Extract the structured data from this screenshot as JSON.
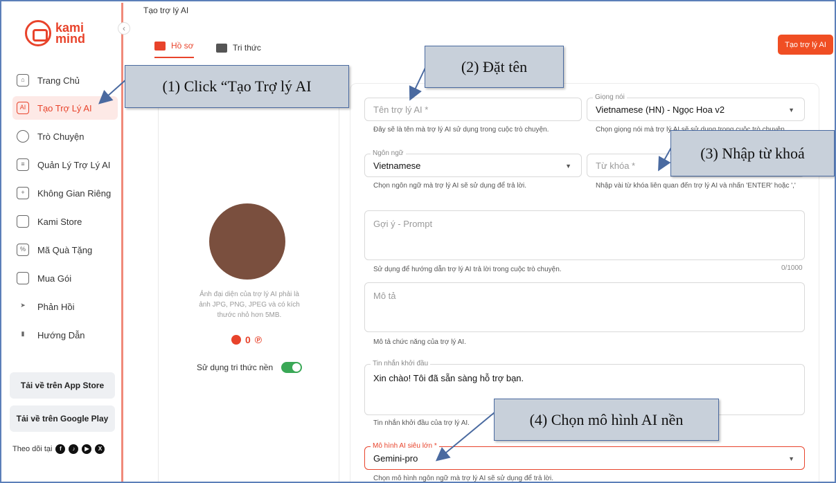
{
  "sidebar": {
    "logo_line1": "kami",
    "logo_line2": "mind",
    "collapse_icon": "‹",
    "items": [
      {
        "label": "Trang Chủ",
        "icon": "home-icon",
        "glyph": "⌂"
      },
      {
        "label": "Tạo Trợ Lý AI",
        "icon": "create-ai-icon",
        "glyph": "AI"
      },
      {
        "label": "Trò Chuyện",
        "icon": "chat-icon",
        "glyph": ""
      },
      {
        "label": "Quản Lý Trợ Lý AI",
        "icon": "manage-icon",
        "glyph": "≡"
      },
      {
        "label": "Không Gian Riêng",
        "icon": "space-icon",
        "glyph": "+"
      },
      {
        "label": "Kami Store",
        "icon": "store-icon",
        "glyph": ""
      },
      {
        "label": "Mã Quà Tặng",
        "icon": "gift-code-icon",
        "glyph": "%"
      },
      {
        "label": "Mua Gói",
        "icon": "wallet-icon",
        "glyph": ""
      },
      {
        "label": "Phản Hồi",
        "icon": "send-icon",
        "glyph": "➤"
      },
      {
        "label": "Hướng Dẫn",
        "icon": "book-icon",
        "glyph": "▮"
      }
    ],
    "app_store": "Tải về trên App Store",
    "google_play": "Tải về trên Google Play",
    "follow": "Theo dõi tại",
    "socials": [
      "f",
      "♪",
      "▶",
      "X"
    ]
  },
  "header": {
    "title": "Tạo trợ lý AI",
    "tab_profile": "Hồ sơ",
    "tab_knowledge": "Tri thức",
    "create_button": "Tạo trợ lý AI"
  },
  "profile": {
    "avatar_hint": "Ảnh đại diện của trợ lý AI phải là ảnh JPG, PNG, JPEG và có kích thước nhỏ hơn 5MB.",
    "points": "0",
    "points_unit": "℗",
    "use_knowledge_label": "Sử dụng tri thức nền",
    "use_knowledge_on": true
  },
  "form": {
    "name_placeholder": "Tên trợ lý AI *",
    "name_help": "Đây sẽ là tên mà trợ lý AI sử dụng trong cuộc trò chuyện.",
    "voice_label": "Giọng nói",
    "voice_value": "Vietnamese (HN) - Ngọc Hoa v2",
    "voice_help": "Chọn giọng nói mà trợ lý AI sẽ sử dụng trong cuộc trò chuyện.",
    "language_label": "Ngôn ngữ",
    "language_value": "Vietnamese",
    "language_help": "Chọn ngôn ngữ mà trợ lý AI sẽ sử dụng để trả lời.",
    "keyword_placeholder": "Từ khóa *",
    "keyword_help": "Nhập vài từ khóa liên quan đến trợ lý AI và nhấn 'ENTER' hoặc ','",
    "prompt_placeholder": "Gợi ý - Prompt",
    "prompt_help": "Sử dụng để hướng dẫn trợ lý AI trả lời trong cuộc trò chuyện.",
    "prompt_counter": "0/1000",
    "desc_placeholder": "Mô tả",
    "desc_help": "Mô tả chức năng của trợ lý AI.",
    "greeting_label": "Tin nhắn khởi đầu",
    "greeting_value": "Xin chào! Tôi đã sẵn sàng hỗ trợ bạn.",
    "greeting_help": "Tin nhắn khởi đầu của trợ lý AI.",
    "model_label": "Mô hình AI siêu lớn *",
    "model_value": "Gemini-pro",
    "model_help": "Chọn mô hình ngôn ngữ mà trợ lý AI sẽ sử dụng để trả lời.",
    "caret": "▼"
  },
  "annotations": {
    "step1": "(1) Click “Tạo Trợ lý AI",
    "step2": "(2) Đặt tên",
    "step3": "(3) Nhập từ khoá",
    "step4": "(4) Chọn mô hình AI nền"
  },
  "colors": {
    "accent": "#e8432b",
    "callout_bg": "#c8d0da",
    "callout_border": "#4a6aa0",
    "toggle_on": "#3aa856"
  }
}
